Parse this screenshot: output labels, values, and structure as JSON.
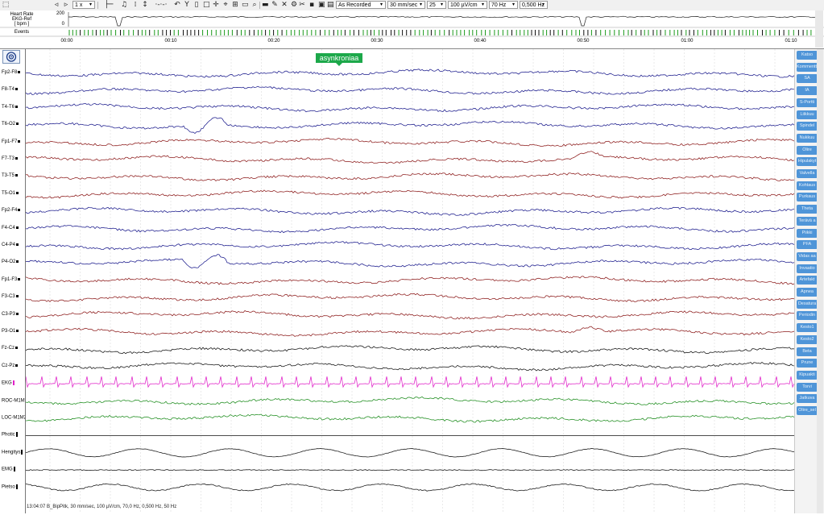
{
  "toolbar": {
    "speed_select": "1 x",
    "montage_select": "As Recorded",
    "paper_speed": "30 mm/sec",
    "channels_select": "25",
    "sensitivity": "100 µV/cm",
    "high_filter": "70 Hz",
    "low_filter": "0,500 Hz"
  },
  "overview": {
    "hr_label_1": "Heart Rate",
    "hr_label_2": "EKG-Ref",
    "hr_label_3": "[ bpm ]",
    "hr_max": "200",
    "hr_min": "0",
    "events_label": "Events",
    "time_labels": [
      "00:00",
      "00:10",
      "00:20",
      "00:30",
      "00:40",
      "00:50",
      "01:00",
      "01:10"
    ]
  },
  "channels": [
    {
      "label": "Fp2-F8",
      "color": "#1a1a8c"
    },
    {
      "label": "F8-T4",
      "color": "#1a1a8c"
    },
    {
      "label": "T4-T6",
      "color": "#1a1a8c"
    },
    {
      "label": "T6-O2",
      "color": "#1a1a8c"
    },
    {
      "label": "Fp1-F7",
      "color": "#8c1a1a"
    },
    {
      "label": "F7-T3",
      "color": "#8c1a1a"
    },
    {
      "label": "T3-T5",
      "color": "#8c1a1a"
    },
    {
      "label": "T5-O1",
      "color": "#8c1a1a"
    },
    {
      "label": "Fp2-F4",
      "color": "#1a1a8c"
    },
    {
      "label": "F4-C4",
      "color": "#1a1a8c"
    },
    {
      "label": "C4-P4",
      "color": "#1a1a8c"
    },
    {
      "label": "P4-O2",
      "color": "#1a1a8c"
    },
    {
      "label": "Fp1-F3",
      "color": "#8c1a1a"
    },
    {
      "label": "F3-C3",
      "color": "#8c1a1a"
    },
    {
      "label": "C3-P3",
      "color": "#8c1a1a"
    },
    {
      "label": "P3-O1",
      "color": "#8c1a1a"
    },
    {
      "label": "Fz-Cz",
      "color": "#111111"
    },
    {
      "label": "Cz-Pz",
      "color": "#111111"
    },
    {
      "label": "EKG",
      "color": "#e020c8"
    },
    {
      "label": "ROC-M1M2",
      "color": "#1c8c1c"
    },
    {
      "label": "LOC-M1M2",
      "color": "#1c8c1c"
    },
    {
      "label": "Photic",
      "color": "#111111"
    },
    {
      "label": "Hengitys",
      "color": "#111111"
    },
    {
      "label": "EMG",
      "color": "#111111"
    },
    {
      "label": "Pietso",
      "color": "#111111"
    }
  ],
  "event_annotation": "asynkroniaa",
  "footer": "13:04:07 B_BipPitk, 30 mm/sec, 100 µV/cm, 70,0 Hz, 0,500 Hz, 50 Hz",
  "markers": [
    "Katso",
    "Kommentti",
    "SA",
    "IA",
    "S-Portti",
    "Liikkuu",
    "Spindel",
    "Nukkuu",
    "Olire",
    "Hipulakyt",
    "Valvella",
    "Kohtaus",
    "Purkaus",
    "Theta",
    "Terävä a",
    "Piikki",
    "PFA",
    "Vidas aa",
    "Invaatio",
    "Artefakt",
    "Apnea",
    "Desatura",
    "Periodin",
    "Kesto1",
    "Kesto2",
    "Beta",
    "Prune",
    "Kipuakti",
    "Torvi",
    "Jatkuva",
    "Olire_sel"
  ],
  "colors": {
    "event_tag": "#1ca84a",
    "marker_button": "#4f95d8",
    "ekg_trace": "#e020c8"
  }
}
